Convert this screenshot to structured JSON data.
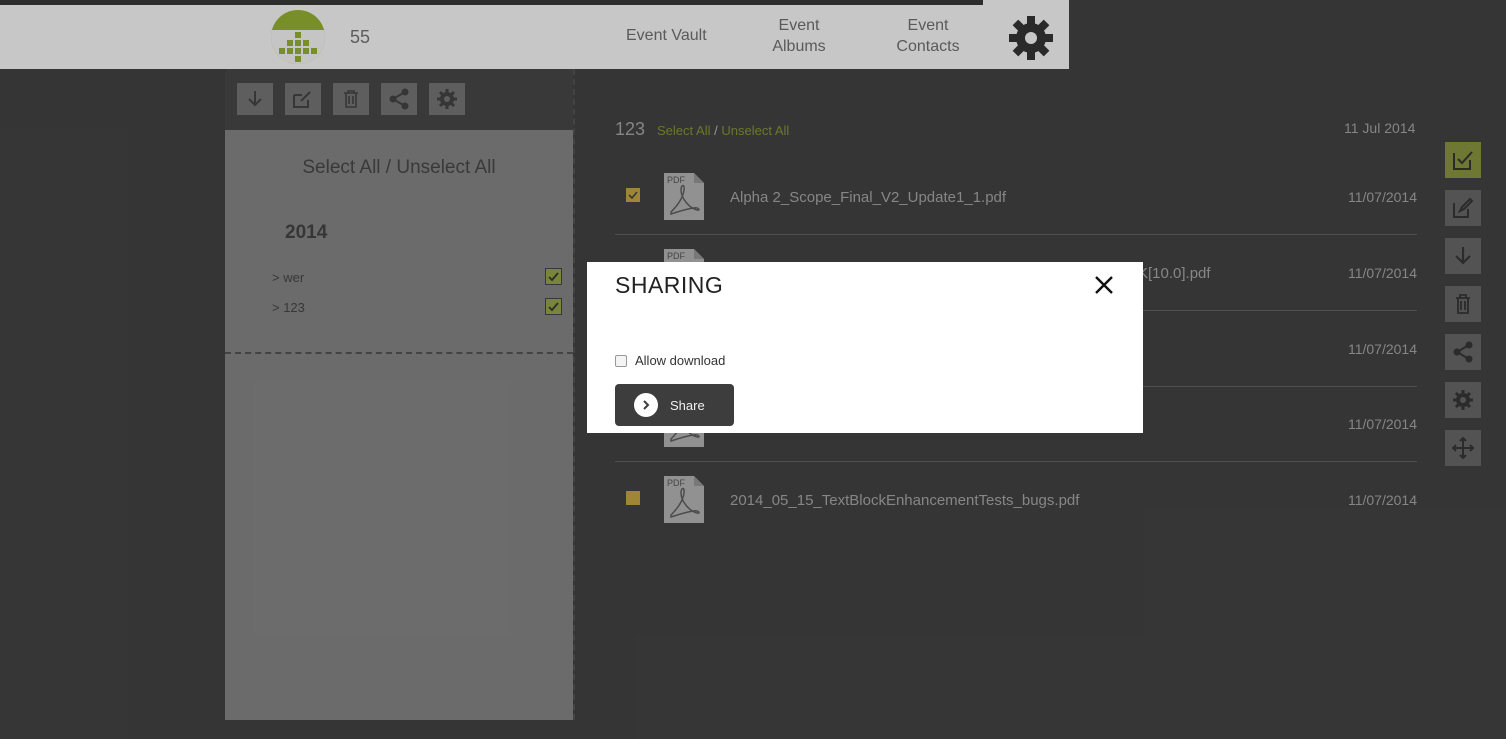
{
  "header": {
    "user_count": "55",
    "nav": [
      {
        "label": "Event Vault"
      },
      {
        "label": "Event\nAlbums"
      },
      {
        "label": "Event\nContacts"
      }
    ],
    "settings_icon": "gear-icon"
  },
  "left_panel": {
    "toolbar_icons": [
      "download-icon",
      "edit-icon",
      "trash-icon",
      "share-icon",
      "settings-icon"
    ],
    "select_all_label": "Select All / Unselect All",
    "year": "2014",
    "albums": [
      {
        "label": "> wer",
        "checked": true
      },
      {
        "label": "> 123",
        "checked": true
      }
    ]
  },
  "content": {
    "album_title": "123",
    "select_all": "Select All",
    "separator": "/",
    "unselect_all": "Unselect All",
    "album_date": "11 Jul 2014",
    "files": [
      {
        "name": "Alpha 2_Scope_Final_V2_Update1_1.pdf",
        "date": "11/07/2014",
        "checked": true
      },
      {
        "name": "K[10.0].pdf",
        "date": "11/07/2014",
        "checked": false
      },
      {
        "name": "",
        "date": "11/07/2014",
        "checked": false
      },
      {
        "name": "",
        "date": "11/07/2014",
        "checked": false
      },
      {
        "name": "2014_05_15_TextBlockEnhancementTests_bugs.pdf",
        "date": "11/07/2014",
        "checked": false
      }
    ]
  },
  "side_tools": [
    "select-check-icon",
    "edit-icon",
    "download-icon",
    "trash-icon",
    "share-icon",
    "settings-icon",
    "move-icon"
  ],
  "modal": {
    "title": "SHARING",
    "allow_download_label": "Allow download",
    "allow_download_checked": false,
    "share_button_label": "Share"
  },
  "colors": {
    "accent_green": "#7e8a36",
    "check_gold": "#b99b3a",
    "background": "#393939"
  }
}
